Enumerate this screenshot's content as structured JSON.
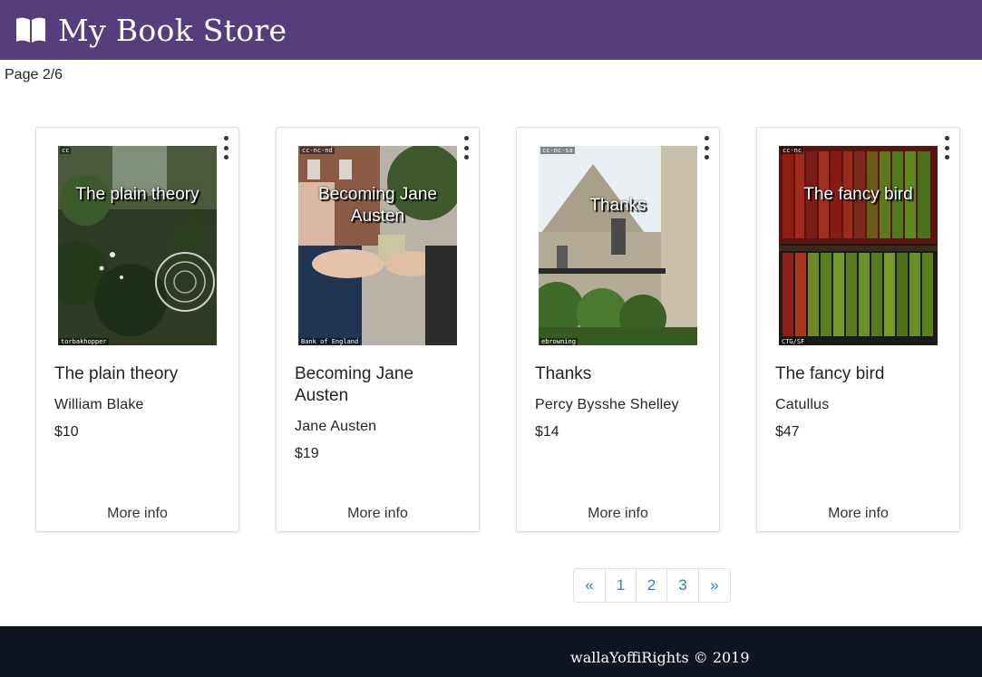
{
  "header": {
    "title": "My Book Store",
    "logo_icon": "open-book-icon",
    "background": "#563d7c"
  },
  "pager_text": "Page 2/6",
  "books": [
    {
      "title": "The plain theory",
      "cover_title": "The plain theory",
      "author": "William Blake",
      "price": "$10",
      "license": "cc",
      "credit": "torbakhopper",
      "more": "More info"
    },
    {
      "title": "Becoming Jane Austen",
      "cover_title": "Becoming Jane Austen",
      "author": "Jane Austen",
      "price": "$19",
      "license": "cc-nc-nd",
      "credit": "Bank of England",
      "more": "More info"
    },
    {
      "title": "Thanks",
      "cover_title": "Thanks",
      "author": "Percy Bysshe Shelley",
      "price": "$14",
      "license": "cc-nc-sa",
      "credit": "ebrowning",
      "more": "More info"
    },
    {
      "title": "The fancy bird",
      "cover_title": "The fancy bird",
      "author": "Catullus",
      "price": "$47",
      "license": "cc-nc",
      "credit": "CTG/SF",
      "more": "More info"
    }
  ],
  "pagination": {
    "prev": "«",
    "pages": [
      "1",
      "2",
      "3"
    ],
    "next": "»",
    "link_color": "#2b7de9"
  },
  "footer": {
    "text": "wallaYoffiRights © 2019",
    "background": "#101522"
  }
}
